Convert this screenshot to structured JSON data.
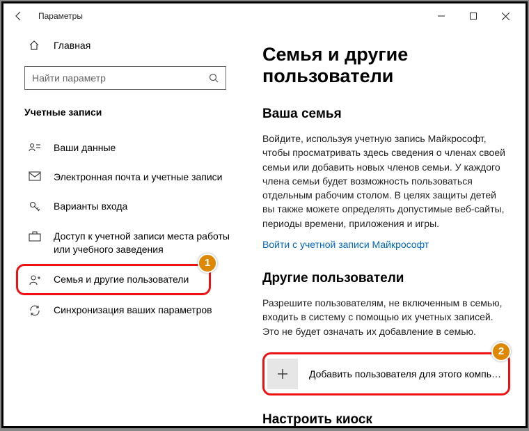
{
  "window": {
    "title": "Параметры"
  },
  "sidebar": {
    "home": "Главная",
    "search_placeholder": "Найти параметр",
    "section": "Учетные записи",
    "items": [
      {
        "icon": "person-card-icon",
        "label": "Ваши данные"
      },
      {
        "icon": "mail-icon",
        "label": "Электронная почта и учетные записи"
      },
      {
        "icon": "key-icon",
        "label": "Варианты входа"
      },
      {
        "icon": "briefcase-icon",
        "label": "Доступ к учетной записи места работы или учебного заведения"
      },
      {
        "icon": "family-icon",
        "label": "Семья и другие пользователи"
      },
      {
        "icon": "sync-icon",
        "label": "Синхронизация ваших параметров"
      }
    ]
  },
  "content": {
    "heading": "Семья и другие пользователи",
    "family": {
      "heading": "Ваша семья",
      "text": "Войдите, используя учетную запись Майкрософт, чтобы просматривать здесь сведения о членах своей семьи или добавить новых членов семьи. У каждого члена семьи будет возможность пользоваться отдельным рабочим столом. В целях защиты детей вы также можете определять допустимые веб-сайты, периоды времени, приложения и игры.",
      "link": "Войти с учетной записи Майкрософт"
    },
    "others": {
      "heading": "Другие пользователи",
      "text": "Разрешите пользователям, не включенным в семью, входить в систему с помощью их учетных записей. Это не будет означать их добавление в семью.",
      "add_button": "Добавить пользователя для этого компьюте..."
    },
    "kiosk": {
      "heading": "Настроить киоск"
    }
  },
  "annotations": {
    "one": "1",
    "two": "2"
  }
}
